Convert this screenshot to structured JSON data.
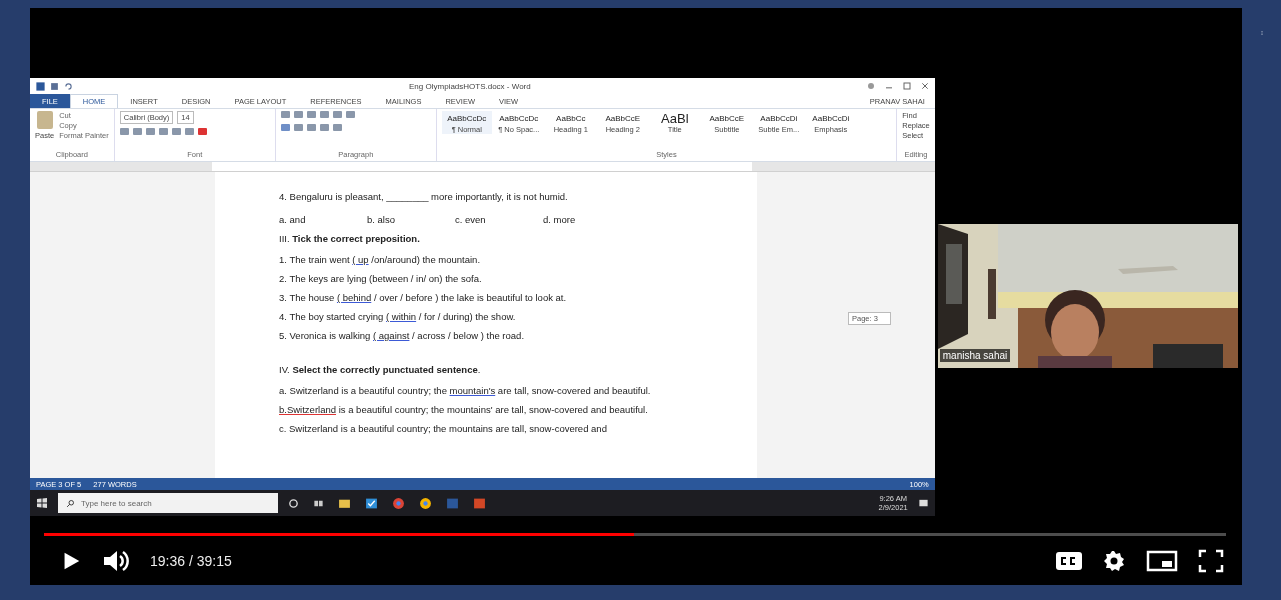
{
  "word": {
    "title": "Eng OlympiadsHOTS.docx - Word",
    "account": "PRANAV SAHAI",
    "tabs": [
      {
        "label": "FILE",
        "selected": false,
        "kind": "file"
      },
      {
        "label": "HOME",
        "selected": true,
        "kind": "tab"
      },
      {
        "label": "INSERT",
        "selected": false,
        "kind": "tab"
      },
      {
        "label": "DESIGN",
        "selected": false,
        "kind": "tab"
      },
      {
        "label": "PAGE LAYOUT",
        "selected": false,
        "kind": "tab"
      },
      {
        "label": "REFERENCES",
        "selected": false,
        "kind": "tab"
      },
      {
        "label": "MAILINGS",
        "selected": false,
        "kind": "tab"
      },
      {
        "label": "REVIEW",
        "selected": false,
        "kind": "tab"
      },
      {
        "label": "VIEW",
        "selected": false,
        "kind": "tab"
      }
    ],
    "clipboard": {
      "paste": "Paste",
      "items": [
        "Cut",
        "Copy",
        "Format Painter"
      ],
      "label": "Clipboard"
    },
    "font": {
      "family": "Calibri (Body)",
      "size": "14",
      "label": "Font"
    },
    "paragraph": {
      "label": "Paragraph"
    },
    "styles": {
      "label": "Styles",
      "items": [
        {
          "sample": "AaBbCcDc",
          "name": "¶ Normal",
          "selected": true
        },
        {
          "sample": "AaBbCcDc",
          "name": "¶ No Spac...",
          "selected": false
        },
        {
          "sample": "AaBbCc",
          "name": "Heading 1",
          "selected": false
        },
        {
          "sample": "AaBbCcE",
          "name": "Heading 2",
          "selected": false
        },
        {
          "sample": "AaBl",
          "name": "Title",
          "selected": false
        },
        {
          "sample": "AaBbCcE",
          "name": "Subtitle",
          "selected": false
        },
        {
          "sample": "AaBbCcDi",
          "name": "Subtle Em...",
          "selected": false
        },
        {
          "sample": "AaBbCcDi",
          "name": "Emphasis",
          "selected": false
        }
      ]
    },
    "editing": {
      "label": "Editing",
      "items": [
        "Find",
        "Replace",
        "Select"
      ]
    },
    "document": {
      "lines": [
        {
          "kind": "text",
          "parts": [
            {
              "text": "4. Bengaluru is pleasant, ________ more importantly, it is not humid."
            }
          ]
        },
        {
          "kind": "options",
          "items": [
            "a. and",
            "b. also",
            "c. even",
            "d. more"
          ]
        },
        {
          "kind": "heading",
          "text": "III. **Tick the correct preposition.**"
        },
        {
          "kind": "text",
          "parts": [
            {
              "text": "1. The train went "
            },
            {
              "text": "( up",
              "underlined": true
            },
            {
              "text": " /on/around) the mountain."
            }
          ]
        },
        {
          "kind": "text",
          "parts": [
            {
              "text": "2. The keys are lying (between / in/ on) the sofa."
            }
          ]
        },
        {
          "kind": "text",
          "parts": [
            {
              "text": "3. The house "
            },
            {
              "text": "( behind",
              "underlined": true
            },
            {
              "text": " / over / before ) the lake is beautiful to look at."
            }
          ]
        },
        {
          "kind": "text",
          "parts": [
            {
              "text": "4. The boy started crying "
            },
            {
              "text": "( within",
              "underlined": true
            },
            {
              "text": " / for / during) the show."
            }
          ]
        },
        {
          "kind": "text",
          "parts": [
            {
              "text": "5. Veronica is walking "
            },
            {
              "text": "( against",
              "underlined": true
            },
            {
              "text": " / across / below ) the road."
            }
          ]
        },
        {
          "kind": "heading",
          "text": "IV. **Select the correctly punctuated sentence**."
        },
        {
          "kind": "text",
          "parts": [
            {
              "text": "a. Switzerland is a beautiful country; the "
            },
            {
              "text": "mountain's",
              "underlined": true
            },
            {
              "text": " are tall, snow-covered and beautiful."
            }
          ]
        },
        {
          "kind": "text",
          "parts": [
            {
              "text": "b.Switzerland",
              "misspelled": true
            },
            {
              "text": " is a beautiful country; the mountains' are tall, snow-covered and beautiful."
            }
          ]
        },
        {
          "kind": "text",
          "parts": [
            {
              "text": "c. Switzerland is a beautiful country; the mountains are tall, snow-covered and"
            }
          ]
        }
      ]
    },
    "page_tooltip": "Page: 3",
    "status": {
      "page": "PAGE 3 OF 5",
      "words": "277 WORDS",
      "zoom": "100%"
    }
  },
  "taskbar": {
    "search_placeholder": "Type here to search",
    "time": "9:26 AM",
    "date": "2/9/2021"
  },
  "webcam": {
    "name": "manisha sahai"
  },
  "player": {
    "progress": {
      "level": 0.499
    },
    "time": "19:36 / 39:15"
  }
}
